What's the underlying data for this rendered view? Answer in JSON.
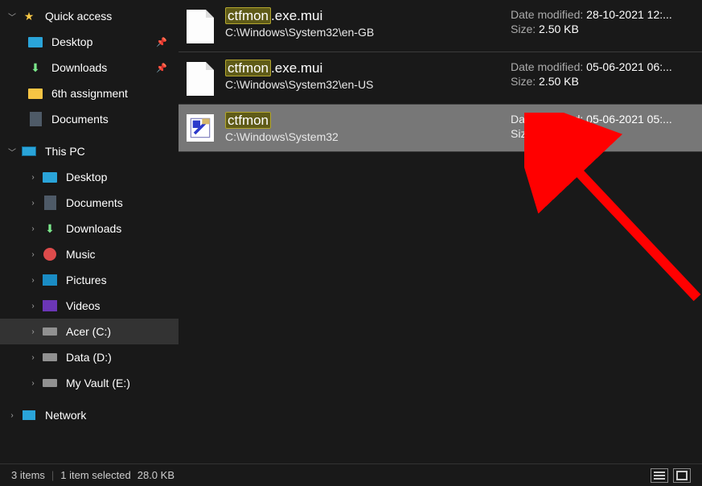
{
  "sidebar": {
    "quickAccess": {
      "label": "Quick access",
      "items": [
        {
          "label": "Desktop",
          "kind": "desktop",
          "pinned": true
        },
        {
          "label": "Downloads",
          "kind": "downloads",
          "pinned": true
        },
        {
          "label": "6th assignment",
          "kind": "folder",
          "pinned": false
        },
        {
          "label": "Documents",
          "kind": "documents",
          "pinned": false
        }
      ]
    },
    "thisPC": {
      "label": "This PC",
      "items": [
        {
          "label": "Desktop",
          "kind": "desktop"
        },
        {
          "label": "Documents",
          "kind": "documents"
        },
        {
          "label": "Downloads",
          "kind": "downloads"
        },
        {
          "label": "Music",
          "kind": "music"
        },
        {
          "label": "Pictures",
          "kind": "pictures"
        },
        {
          "label": "Videos",
          "kind": "videos"
        },
        {
          "label": "Acer (C:)",
          "kind": "drive",
          "selected": true
        },
        {
          "label": "Data (D:)",
          "kind": "drive"
        },
        {
          "label": "My Vault (E:)",
          "kind": "drive"
        }
      ]
    },
    "network": {
      "label": "Network"
    }
  },
  "results": [
    {
      "highlight": "ctfmon",
      "suffix": ".exe.mui",
      "path": "C:\\Windows\\System32\\en-GB",
      "dateLabel": "Date modified:",
      "date": "28-10-2021 12:...",
      "sizeLabel": "Size:",
      "size": "2.50 KB",
      "iconKind": "file",
      "selected": false
    },
    {
      "highlight": "ctfmon",
      "suffix": ".exe.mui",
      "path": "C:\\Windows\\System32\\en-US",
      "dateLabel": "Date modified:",
      "date": "05-06-2021 06:...",
      "sizeLabel": "Size:",
      "size": "2.50 KB",
      "iconKind": "file",
      "selected": false
    },
    {
      "highlight": "ctfmon",
      "suffix": "",
      "path": "C:\\Windows\\System32",
      "dateLabel": "Date modified:",
      "date": "05-06-2021 05:...",
      "sizeLabel": "Size:",
      "size": "28.0 KB",
      "iconKind": "exe",
      "selected": true
    }
  ],
  "status": {
    "items": "3 items",
    "selected": "1 item selected",
    "size": "28.0 KB"
  }
}
